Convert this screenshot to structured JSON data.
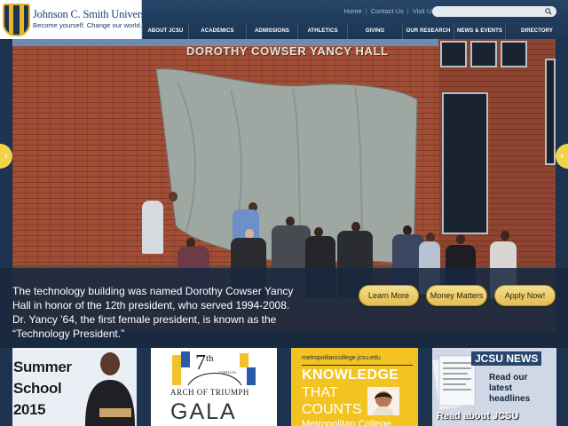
{
  "header": {
    "logo_name": "Johnson C. Smith University",
    "logo_tagline": "Become yourself. Change our world.",
    "utility_links": [
      "Home",
      "Contact Us",
      "Visit Us"
    ],
    "search": {
      "value": "",
      "placeholder": ""
    },
    "nav": [
      "About JCSU",
      "Academics",
      "Admissions",
      "Athletics",
      "Giving",
      "Our Research",
      "News & Events",
      "Directory"
    ]
  },
  "hero": {
    "building_sign": "DOROTHY COWSER YANCY HALL",
    "caption": "The technology building was named Dorothy Cowser Yancy Hall in honor of the 12th president, who served 1994-2008. Dr. Yancy '64, the first female president, is known as the “Technology President.”",
    "buttons": [
      "Learn More",
      "Money Matters",
      "Apply Now!"
    ],
    "prev_icon": "chevron-left-icon",
    "next_icon": "chevron-right-icon"
  },
  "tiles": {
    "summer": {
      "lines": [
        "Summer",
        "School",
        "2015"
      ]
    },
    "gala": {
      "number": "7",
      "suffix": "th",
      "annual": "ANNUAL",
      "arch": "ARCH OF TRIUMPH",
      "gala": "GALA"
    },
    "metro": {
      "url": "metropolitancollege.jcsu.edu",
      "line1": "KNOWLEDGE",
      "line2": "THAT",
      "line3": "COUNTS",
      "line4": "Metropolitan College"
    },
    "news": {
      "title": "JCSU NEWS",
      "body": "Read our latest headlines",
      "footer": "Read about JCSU"
    }
  },
  "colors": {
    "navy": "#1e3350",
    "gold": "#e5b52b",
    "button_gold": "#f5df8f",
    "brick": "#a24e37"
  }
}
